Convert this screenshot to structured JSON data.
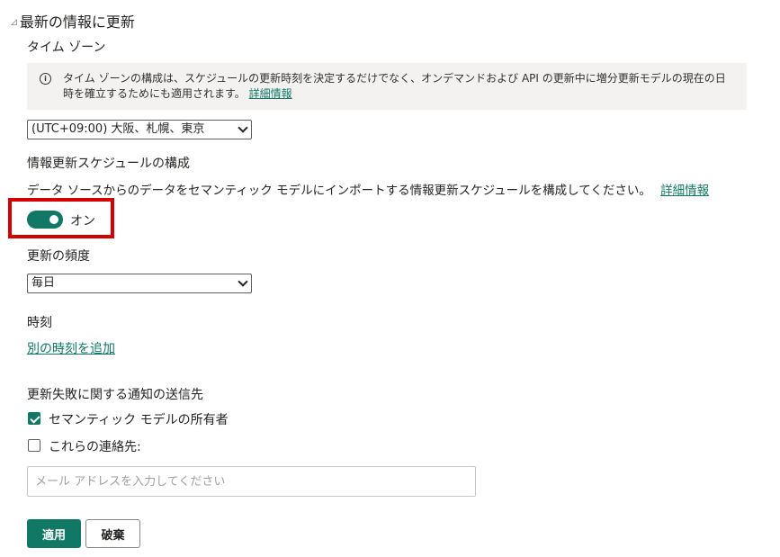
{
  "section": {
    "title": "最新の情報に更新",
    "collapse_glyph": "◿"
  },
  "timezone": {
    "label": "タイム ゾーン",
    "info_text": "タイム ゾーンの構成は、スケジュールの更新時刻を決定するだけでなく、オンデマンドおよび API の更新中に増分更新モデルの現在の日時を確立するためにも適用されます。",
    "info_link": "詳細情報",
    "selected": "(UTC+09:00) 大阪、札幌、東京"
  },
  "schedule": {
    "label": "情報更新スケジュールの構成",
    "description": "データ ソースからのデータをセマンティック モデルにインポートする情報更新スケジュールを構成してください。",
    "link": "詳細情報",
    "toggle_label": "オン",
    "toggle_on": true,
    "highlight_color": "#d40000"
  },
  "frequency": {
    "label": "更新の頻度",
    "selected": "毎日"
  },
  "time": {
    "label": "時刻",
    "add_link": "別の時刻を追加"
  },
  "notify": {
    "label": "更新失敗に関する通知の送信先",
    "owner_label": "セマンティック モデルの所有者",
    "owner_checked": true,
    "contacts_label": "これらの連絡先:",
    "contacts_checked": false,
    "email_placeholder": "メール アドレスを入力してください"
  },
  "buttons": {
    "apply": "適用",
    "discard": "破棄"
  },
  "colors": {
    "accent": "#117865",
    "info_bg": "#f3f2f1"
  }
}
